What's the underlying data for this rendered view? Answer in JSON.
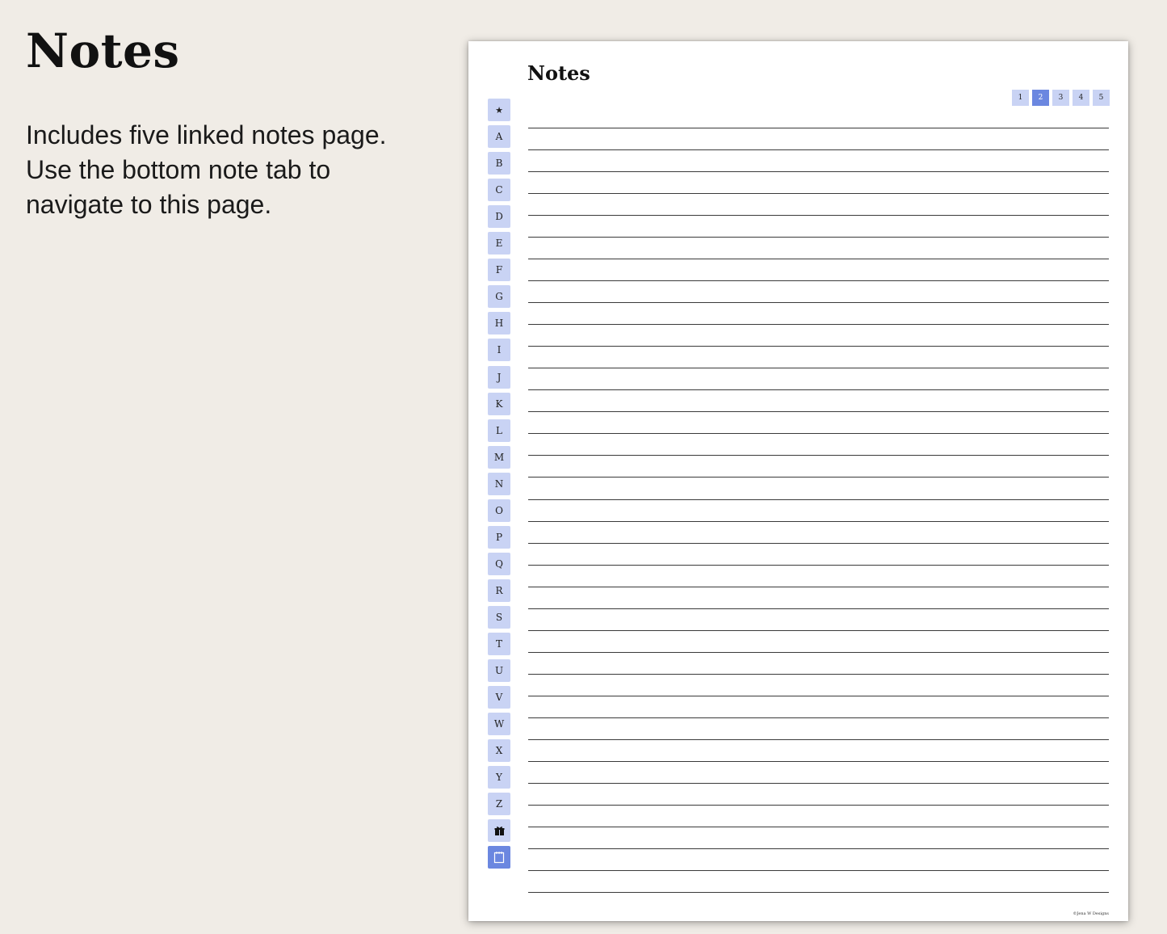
{
  "heading": "Notes",
  "description_lines": [
    "Includes five linked notes page.",
    "Use the bottom note tab to",
    "navigate to this page."
  ],
  "page": {
    "title": "Notes",
    "page_tabs": [
      "1",
      "2",
      "3",
      "4",
      "5"
    ],
    "active_page_tab": "2",
    "side_tabs": [
      {
        "label": "★",
        "icon": "star-icon"
      },
      {
        "label": "A"
      },
      {
        "label": "B"
      },
      {
        "label": "C"
      },
      {
        "label": "D"
      },
      {
        "label": "E"
      },
      {
        "label": "F"
      },
      {
        "label": "G"
      },
      {
        "label": "H"
      },
      {
        "label": "I"
      },
      {
        "label": "J"
      },
      {
        "label": "K"
      },
      {
        "label": "L"
      },
      {
        "label": "M"
      },
      {
        "label": "N"
      },
      {
        "label": "O"
      },
      {
        "label": "P"
      },
      {
        "label": "Q"
      },
      {
        "label": "R"
      },
      {
        "label": "S"
      },
      {
        "label": "T"
      },
      {
        "label": "U"
      },
      {
        "label": "V"
      },
      {
        "label": "W"
      },
      {
        "label": "X"
      },
      {
        "label": "Y"
      },
      {
        "label": "Z"
      },
      {
        "label": "",
        "icon": "gift-icon"
      },
      {
        "label": "",
        "icon": "notepad-icon",
        "active": true
      }
    ],
    "ruled_line_count": 36,
    "copyright": "©Jena W Designs"
  },
  "colors": {
    "background": "#f0ece6",
    "tab": "#c9d3f4",
    "tab_active": "#6b87e0"
  }
}
